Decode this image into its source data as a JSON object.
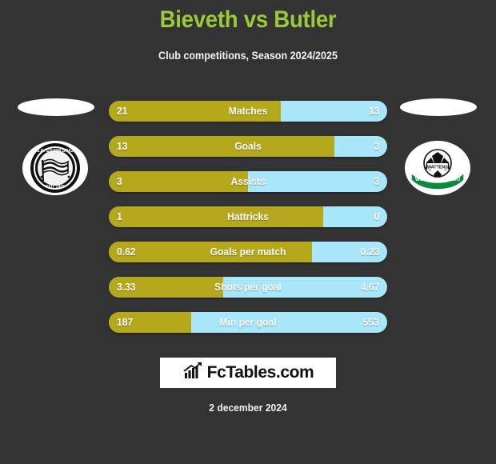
{
  "header": {
    "title": "Bieveth vs Butler",
    "subtitle": "Club competitions, Season 2024/2025",
    "title_color": "#9ac93a"
  },
  "crests": {
    "home": {
      "name": "SK Sturm Graz",
      "caption_top": "S.K. STURM GRAZ",
      "caption_bottom": "SEIT 1909"
    },
    "away": {
      "name": "WSG Swarovski Tirol",
      "caption_banner": "WSG SWAROVSKI",
      "caption_center": "WATTENS"
    }
  },
  "footer": {
    "brand_text": "FcTables.com",
    "brand_icon": "bar-chart-arrow-icon",
    "date": "2 december 2024"
  },
  "colors": {
    "home_bar": "#b5a81c",
    "away_bar": "#a8e6fa",
    "background": "#333333",
    "label_text": "#ffffff"
  },
  "chart_data": {
    "type": "bar",
    "title": "Bieveth vs Butler",
    "subtitle": "Club competitions, Season 2024/2025",
    "orientation": "horizontal-diverging",
    "legend": [
      "Bieveth",
      "Butler"
    ],
    "legend_position": "none",
    "grid": false,
    "categories": [
      "Matches",
      "Goals",
      "Assists",
      "Hattricks",
      "Goals per match",
      "Shots per goal",
      "Min per goal"
    ],
    "series": [
      {
        "name": "Bieveth",
        "color": "#b5a81c",
        "values": [
          21,
          13,
          3,
          1,
          0.62,
          3.33,
          187
        ]
      },
      {
        "name": "Butler",
        "color": "#a8e6fa",
        "values": [
          13,
          3,
          3,
          0,
          0.23,
          4.67,
          553
        ]
      }
    ],
    "rows": [
      {
        "label": "Matches",
        "home": "21",
        "away": "13",
        "home_pct": 61.8
      },
      {
        "label": "Goals",
        "home": "13",
        "away": "3",
        "home_pct": 81.0
      },
      {
        "label": "Assists",
        "home": "3",
        "away": "3",
        "home_pct": 50.0
      },
      {
        "label": "Hattricks",
        "home": "1",
        "away": "0",
        "home_pct": 77.0
      },
      {
        "label": "Goals per match",
        "home": "0.62",
        "away": "0.23",
        "home_pct": 73.0
      },
      {
        "label": "Shots per goal",
        "home": "3.33",
        "away": "4.67",
        "home_pct": 41.0
      },
      {
        "label": "Min per goal",
        "home": "187",
        "away": "553",
        "home_pct": 29.5
      }
    ]
  }
}
